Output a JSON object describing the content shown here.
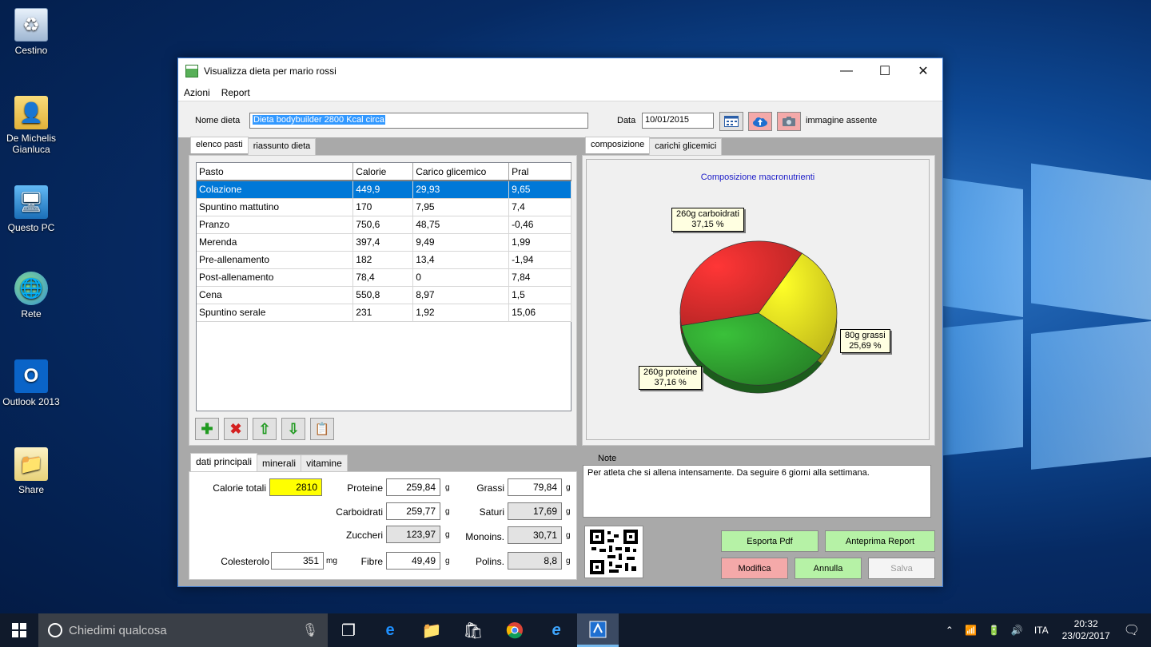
{
  "desktop": {
    "icons": [
      {
        "label": "Cestino"
      },
      {
        "label": "De Michelis Gianluca"
      },
      {
        "label": "Questo PC"
      },
      {
        "label": "Rete"
      },
      {
        "label": "Outlook 2013"
      },
      {
        "label": "Share"
      }
    ]
  },
  "window": {
    "title": "Visualizza dieta per mario rossi",
    "menu": [
      "Azioni",
      "Report"
    ],
    "nome_dieta_label": "Nome dieta",
    "nome_dieta_value": "Dieta bodybuilder 2800 Kcal circa",
    "data_label": "Data",
    "data_value": "10/01/2015",
    "image_status": "immagine assente"
  },
  "left_tabs": [
    "elenco pasti",
    "riassunto dieta"
  ],
  "meals_table": {
    "columns": [
      "Pasto",
      "Calorie",
      "Carico glicemico",
      "Pral"
    ],
    "rows": [
      [
        "Colazione",
        "449,9",
        "29,93",
        "9,65"
      ],
      [
        "Spuntino mattutino",
        "170",
        "7,95",
        "7,4"
      ],
      [
        "Pranzo",
        "750,6",
        "48,75",
        "-0,46"
      ],
      [
        "Merenda",
        "397,4",
        "9,49",
        "1,99"
      ],
      [
        "Pre-allenamento",
        "182",
        "13,4",
        "-1,94"
      ],
      [
        "Post-allenamento",
        "78,4",
        "0",
        "7,84"
      ],
      [
        "Cena",
        "550,8",
        "8,97",
        "1,5"
      ],
      [
        "Spuntino serale",
        "231",
        "1,92",
        "15,06"
      ]
    ]
  },
  "right_tabs": [
    "composizione",
    "carichi glicemici"
  ],
  "chart_data": {
    "type": "pie",
    "title": "Composizione macronutrienti",
    "slices": [
      {
        "name": "carboidrati",
        "label_line1": "260g carboidrati",
        "label_line2": "37,15 %",
        "value": 37.15,
        "color": "#d92b2b"
      },
      {
        "name": "grassi",
        "label_line1": "80g grassi",
        "label_line2": "25,69 %",
        "value": 25.69,
        "color": "#e8e020"
      },
      {
        "name": "proteine",
        "label_line1": "260g proteine",
        "label_line2": "37,16 %",
        "value": 37.16,
        "color": "#2e9a2e"
      }
    ]
  },
  "bottom_tabs": [
    "dati principali",
    "minerali",
    "vitamine"
  ],
  "nutrients": {
    "calorie_totali_label": "Calorie totali",
    "calorie_totali": "2810",
    "proteine_label": "Proteine",
    "proteine": "259,84",
    "grassi_label": "Grassi",
    "grassi": "79,84",
    "carboidrati_label": "Carboidrati",
    "carboidrati": "259,77",
    "saturi_label": "Saturi",
    "saturi": "17,69",
    "zuccheri_label": "Zuccheri",
    "zuccheri": "123,97",
    "monoins_label": "Monoins.",
    "monoins": "30,71",
    "colesterolo_label": "Colesterolo",
    "colesterolo": "351",
    "fibre_label": "Fibre",
    "fibre": "49,49",
    "polins_label": "Polins.",
    "polins": "8,8",
    "unit_g": "g",
    "unit_mg": "mg"
  },
  "note": {
    "label": "Note",
    "text": "Per atleta che si allena intensamente. Da seguire 6 giorni alla settimana."
  },
  "buttons": {
    "esporta_pdf": "Esporta Pdf",
    "anteprima_report": "Anteprima Report",
    "modifica": "Modifica",
    "annulla": "Annulla",
    "salva": "Salva"
  },
  "taskbar": {
    "search_placeholder": "Chiedimi qualcosa",
    "language": "ITA",
    "time": "20:32",
    "date": "23/02/2017"
  }
}
